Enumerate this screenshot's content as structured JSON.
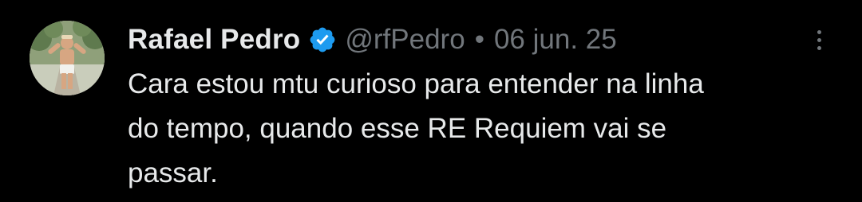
{
  "tweet": {
    "author_name": "Rafael Pedro",
    "handle": "@rfPedro",
    "separator": "•",
    "date": "06 jun. 25",
    "text_lines": [
      "Cara estou mtu curioso para entender na linha",
      "do tempo, quando esse RE Requiem vai se",
      "passar."
    ]
  },
  "icons": {
    "verified": "verified-badge-icon",
    "more": "more-options-icon"
  },
  "colors": {
    "background": "#000000",
    "primary_text": "#e7e9ea",
    "secondary_text": "#71767b",
    "verified_blue": "#1d9bf0"
  }
}
